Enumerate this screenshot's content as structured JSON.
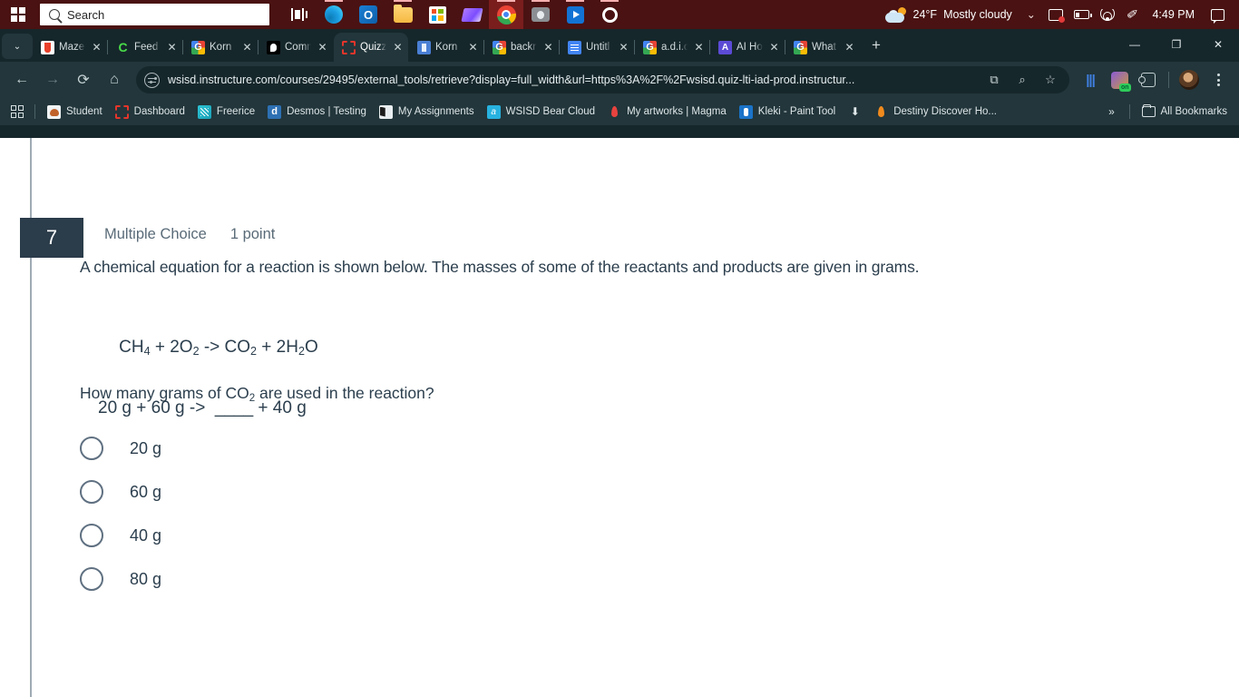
{
  "taskbar": {
    "search_placeholder": "Search",
    "icons": [
      {
        "name": "task-view-icon"
      },
      {
        "name": "edge-icon"
      },
      {
        "name": "outlook-icon"
      },
      {
        "name": "file-explorer-icon"
      },
      {
        "name": "microsoft-store-icon"
      },
      {
        "name": "clipchamp-icon"
      },
      {
        "name": "chrome-icon"
      },
      {
        "name": "camera-icon"
      },
      {
        "name": "movies-tv-icon"
      },
      {
        "name": "settings-icon"
      }
    ],
    "weather_temp": "24°F",
    "weather_desc": "Mostly cloudy",
    "clock": "4:49 PM",
    "bg_color": "#4a1212"
  },
  "browser": {
    "tabs": [
      {
        "label": "Maze",
        "favicon": "maze-icon",
        "active": false
      },
      {
        "label": "Feed",
        "favicon": "feed-icon",
        "active": false
      },
      {
        "label": "Korn",
        "favicon": "google-icon",
        "active": false
      },
      {
        "label": "Comm",
        "favicon": "comm-icon",
        "active": false
      },
      {
        "label": "Quizz",
        "favicon": "quizizz-icon",
        "active": true
      },
      {
        "label": "Korn",
        "favicon": "korn-icon",
        "active": false
      },
      {
        "label": "backr",
        "favicon": "google-icon",
        "active": false
      },
      {
        "label": "Untitl",
        "favicon": "google-docs-icon",
        "active": false
      },
      {
        "label": "a.d.i.c",
        "favicon": "google-icon",
        "active": false
      },
      {
        "label": "AI Ho",
        "favicon": "ai-icon",
        "active": false
      },
      {
        "label": "What",
        "favicon": "google-icon",
        "active": false
      }
    ],
    "new_tab_label": "+",
    "window_controls": {
      "minimize": "—",
      "maximize": "❐",
      "close": "✕"
    },
    "url": "wsisd.instructure.com/courses/29495/external_tools/retrieve?display=full_width&url=https%3A%2F%2Fwsisd.quiz-lti-iad-prod.instructur...",
    "bookmarks": [
      {
        "label": "Student",
        "icon": "student-icon"
      },
      {
        "label": "Dashboard",
        "icon": "dashboard-icon"
      },
      {
        "label": "Freerice",
        "icon": "freerice-icon"
      },
      {
        "label": "Desmos | Testing",
        "icon": "desmos-icon"
      },
      {
        "label": "My Assignments",
        "icon": "book-icon"
      },
      {
        "label": "WSISD Bear Cloud",
        "icon": "bear-cloud-icon"
      },
      {
        "label": "My artworks | Magma",
        "icon": "magma-icon"
      },
      {
        "label": "Kleki - Paint Tool",
        "icon": "kleki-icon"
      },
      {
        "label": "",
        "icon": "download-icon"
      },
      {
        "label": "Destiny Discover Ho...",
        "icon": "destiny-icon"
      }
    ],
    "bookmarks_overflow": "»",
    "all_bookmarks_label": "All Bookmarks"
  },
  "quiz": {
    "question_number": "7",
    "question_type": "Multiple Choice",
    "points": "1 point",
    "stem": "A chemical equation for a reaction is shown below. The masses of some of the reactants and products are given in grams.",
    "equation_line1_pre": "CH",
    "equation_line1": [
      {
        "t": "CH"
      },
      {
        "t": "4",
        "sub": true
      },
      {
        "t": " + 2O"
      },
      {
        "t": "2",
        "sub": true
      },
      {
        "t": " -> CO"
      },
      {
        "t": "2",
        "sub": true
      },
      {
        "t": " + 2H"
      },
      {
        "t": "2",
        "sub": true
      },
      {
        "t": "O"
      }
    ],
    "equation_line2": "20 g + 60 g ->  ____ + 40 g",
    "ask_pre": "How many grams of CO",
    "ask_sub": "2",
    "ask_post": " are used in the reaction?",
    "choices": [
      {
        "label": "20 g",
        "selected": false
      },
      {
        "label": "60 g",
        "selected": false
      },
      {
        "label": "40 g",
        "selected": false
      },
      {
        "label": "80 g",
        "selected": false
      }
    ],
    "badge_color": "#2b3c4a",
    "text_color": "#2b3e4d"
  }
}
